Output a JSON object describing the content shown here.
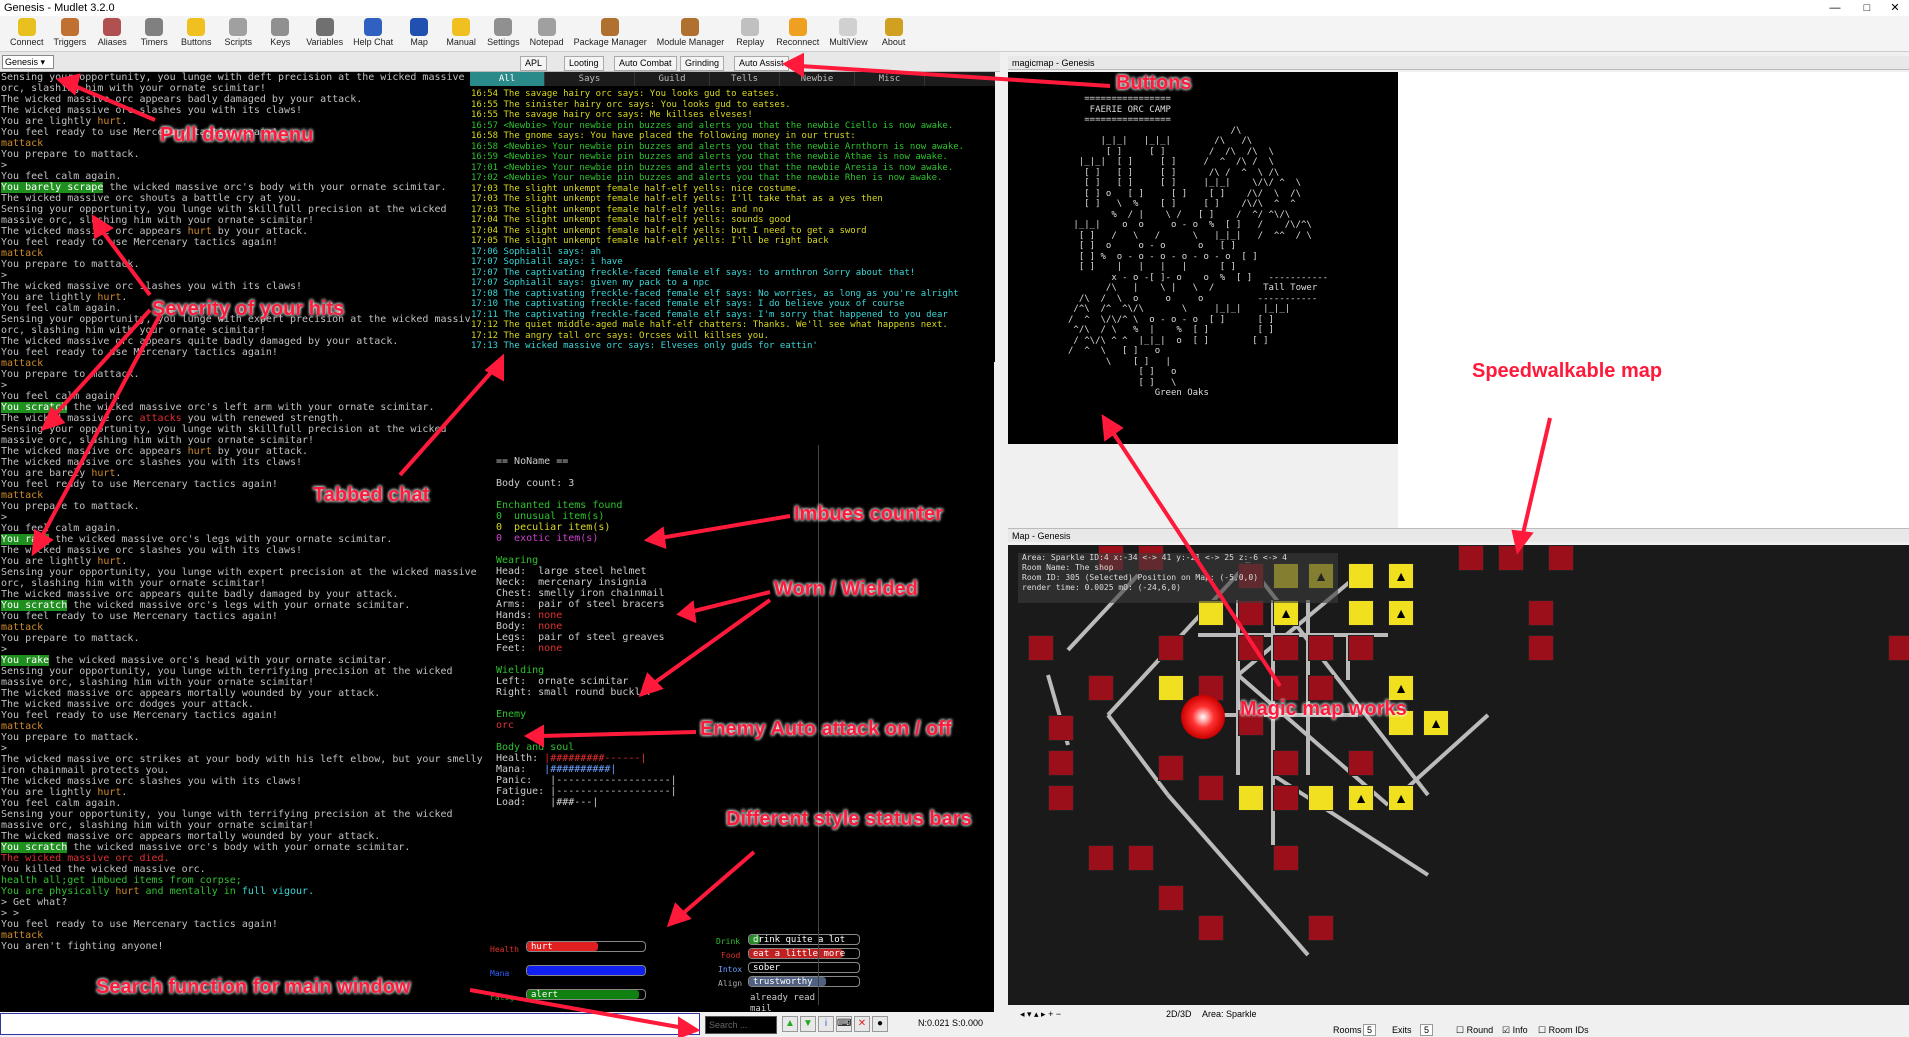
{
  "window": {
    "title": "Genesis - Mudlet 3.2.0",
    "min": "—",
    "max": "□",
    "close": "✕"
  },
  "toolbar": [
    {
      "label": "Connect",
      "icon": "connect-icon",
      "color": "#e8c020"
    },
    {
      "label": "Triggers",
      "icon": "triggers-icon",
      "color": "#c07030"
    },
    {
      "label": "Aliases",
      "icon": "aliases-icon",
      "color": "#b05050"
    },
    {
      "label": "Timers",
      "icon": "timers-icon",
      "color": "#808080"
    },
    {
      "label": "Buttons",
      "icon": "buttons-icon",
      "color": "#f0c020"
    },
    {
      "label": "Scripts",
      "icon": "scripts-icon",
      "color": "#a0a0a0"
    },
    {
      "label": "Keys",
      "icon": "keys-icon",
      "color": "#909090"
    },
    {
      "label": "Variables",
      "icon": "variables-icon",
      "color": "#707070"
    },
    {
      "label": "Help Chat",
      "icon": "chat-icon",
      "color": "#3060c0"
    },
    {
      "label": "Map",
      "icon": "map-icon",
      "color": "#2050b0"
    },
    {
      "label": "Manual",
      "icon": "manual-icon",
      "color": "#f0c020"
    },
    {
      "label": "Settings",
      "icon": "settings-icon",
      "color": "#909090"
    },
    {
      "label": "Notepad",
      "icon": "notepad-icon",
      "color": "#a0a0a0"
    },
    {
      "label": "Package Manager",
      "icon": "package-icon",
      "color": "#b07030"
    },
    {
      "label": "Module Manager",
      "icon": "module-icon",
      "color": "#b07030"
    },
    {
      "label": "Replay",
      "icon": "replay-icon",
      "color": "#c0c0c0"
    },
    {
      "label": "Reconnect",
      "icon": "reconnect-icon",
      "color": "#f0a020"
    },
    {
      "label": "MultiView",
      "icon": "multiview-icon",
      "color": "#d0d0d0"
    },
    {
      "label": "About",
      "icon": "about-icon",
      "color": "#d0a020"
    }
  ],
  "profile": "Genesis ▾",
  "top_tabs": [
    "APL",
    "Looting",
    "Auto Combat",
    "Grinding",
    "Auto Assist"
  ],
  "main_lines": [
    [
      [
        "Sensing your opportunity, you lunge with deft precision at the wicked massive",
        ""
      ]
    ],
    [
      [
        "orc, slashing him with your ornate scimitar!",
        ""
      ]
    ],
    [
      [
        "The wicked massive orc appears badly damaged by your attack.",
        ""
      ]
    ],
    [
      [
        "The wicked massive orc slashes you with its claws!",
        ""
      ]
    ],
    [
      [
        "You are lightly ",
        ""
      ],
      [
        "hurt",
        "or"
      ],
      [
        ".",
        ""
      ]
    ],
    [
      [
        "You feel ready to use Mercenary tactics again!",
        ""
      ]
    ],
    [
      [
        "mattack",
        "or"
      ]
    ],
    [
      [
        "You prepare to mattack.",
        ""
      ]
    ],
    [
      [
        ">",
        ""
      ]
    ],
    [
      [
        "You feel calm again.",
        ""
      ]
    ],
    [
      [
        "You barely scrape",
        "hl"
      ],
      [
        " the wicked massive orc's body with your ornate scimitar.",
        ""
      ]
    ],
    [
      [
        "The wicked massive orc shouts a battle cry at you.",
        ""
      ]
    ],
    [
      [
        "Sensing your opportunity, you lunge with skillfull precision at the wicked",
        ""
      ]
    ],
    [
      [
        "massive orc, slashing him with your ornate scimitar!",
        ""
      ]
    ],
    [
      [
        "The wicked massive orc appears ",
        ""
      ],
      [
        "hurt",
        "or"
      ],
      [
        " by your attack.",
        ""
      ]
    ],
    [
      [
        "You feel ready to use Mercenary tactics again!",
        ""
      ]
    ],
    [
      [
        "mattack",
        "or"
      ]
    ],
    [
      [
        "You prepare to mattack.",
        ""
      ]
    ],
    [
      [
        ">",
        ""
      ]
    ],
    [
      [
        "The wicked massive orc slashes you with its claws!",
        ""
      ]
    ],
    [
      [
        "You are lightly ",
        ""
      ],
      [
        "hurt",
        "or"
      ],
      [
        ".",
        ""
      ]
    ],
    [
      [
        "You feel calm again.",
        ""
      ]
    ],
    [
      [
        "Sensing your opportunity, you lunge with expert precision at the wicked massive",
        ""
      ]
    ],
    [
      [
        "orc, slashing him with your ornate scimitar!",
        ""
      ]
    ],
    [
      [
        "The wicked massive orc appears quite badly damaged by your attack.",
        ""
      ]
    ],
    [
      [
        "You feel ready to use Mercenary tactics again!",
        ""
      ]
    ],
    [
      [
        "mattack",
        "or"
      ]
    ],
    [
      [
        "You prepare to mattack.",
        ""
      ]
    ],
    [
      [
        ">",
        ""
      ]
    ],
    [
      [
        "You feel calm again.",
        ""
      ]
    ],
    [
      [
        "You scratch",
        "hl"
      ],
      [
        " the wicked massive orc's left arm with your ornate scimitar.",
        ""
      ]
    ],
    [
      [
        "The wicked massive orc ",
        ""
      ],
      [
        "attacks",
        "rd"
      ],
      [
        " you with renewed strength.",
        ""
      ]
    ],
    [
      [
        "Sensing your opportunity, you lunge with skillfull precision at the wicked",
        ""
      ]
    ],
    [
      [
        "massive orc, slashing him with your ornate scimitar!",
        ""
      ]
    ],
    [
      [
        "The wicked massive orc appears ",
        ""
      ],
      [
        "hurt",
        "or"
      ],
      [
        " by your attack.",
        ""
      ]
    ],
    [
      [
        "The wicked massive orc slashes you with its claws!",
        ""
      ]
    ],
    [
      [
        "You are barely ",
        ""
      ],
      [
        "hurt",
        "or"
      ],
      [
        ".",
        ""
      ]
    ],
    [
      [
        "You feel ready to use Mercenary tactics again!",
        ""
      ]
    ],
    [
      [
        "mattack",
        "or"
      ]
    ],
    [
      [
        "You prepare to mattack.",
        ""
      ]
    ],
    [
      [
        ">",
        ""
      ]
    ],
    [
      [
        "You feel calm again.",
        ""
      ]
    ],
    [
      [
        "You rake",
        "hl"
      ],
      [
        " the wicked massive orc's legs with your ornate scimitar.",
        ""
      ]
    ],
    [
      [
        "The wicked massive orc slashes you with its claws!",
        ""
      ]
    ],
    [
      [
        "You are lightly ",
        ""
      ],
      [
        "hurt",
        "or"
      ],
      [
        ".",
        ""
      ]
    ],
    [
      [
        "Sensing your opportunity, you lunge with expert precision at the wicked massive",
        ""
      ]
    ],
    [
      [
        "orc, slashing him with your ornate scimitar!",
        ""
      ]
    ],
    [
      [
        "The wicked massive orc appears quite badly damaged by your attack.",
        ""
      ]
    ],
    [
      [
        "You scratch",
        "hl"
      ],
      [
        " the wicked massive orc's legs with your ornate scimitar.",
        ""
      ]
    ],
    [
      [
        "You feel ready to use Mercenary tactics again!",
        ""
      ]
    ],
    [
      [
        "mattack",
        "or"
      ]
    ],
    [
      [
        "You prepare to mattack.",
        ""
      ]
    ],
    [
      [
        ">",
        ""
      ]
    ],
    [
      [
        "You rake",
        "hl"
      ],
      [
        " the wicked massive orc's head with your ornate scimitar.",
        ""
      ]
    ],
    [
      [
        "Sensing your opportunity, you lunge with terrifying precision at the wicked",
        ""
      ]
    ],
    [
      [
        "massive orc, slashing him with your ornate scimitar!",
        ""
      ]
    ],
    [
      [
        "The wicked massive orc appears mortally wounded by your attack.",
        ""
      ]
    ],
    [
      [
        "The wicked massive orc dodges your attack.",
        ""
      ]
    ],
    [
      [
        "You feel ready to use Mercenary tactics again!",
        ""
      ]
    ],
    [
      [
        "mattack",
        "or"
      ]
    ],
    [
      [
        "You prepare to mattack.",
        ""
      ]
    ],
    [
      [
        ">",
        ""
      ]
    ],
    [
      [
        "The wicked massive orc strikes at your body with his left elbow, but your smelly",
        ""
      ]
    ],
    [
      [
        "iron chainmail protects you.",
        ""
      ]
    ],
    [
      [
        "The wicked massive orc slashes you with its claws!",
        ""
      ]
    ],
    [
      [
        "You are lightly ",
        ""
      ],
      [
        "hurt",
        "or"
      ],
      [
        ".",
        ""
      ]
    ],
    [
      [
        "You feel calm again.",
        ""
      ]
    ],
    [
      [
        "Sensing your opportunity, you lunge with terrifying precision at the wicked",
        ""
      ]
    ],
    [
      [
        "massive orc, slashing him with your ornate scimitar!",
        ""
      ]
    ],
    [
      [
        "The wicked massive orc appears mortally wounded by your attack.",
        ""
      ]
    ],
    [
      [
        "You scratch",
        "hl"
      ],
      [
        " the wicked massive orc's body with your ornate scimitar.",
        ""
      ]
    ],
    [
      [
        "The wicked massive orc died.",
        "rd"
      ]
    ],
    [
      [
        "You killed the wicked massive orc.",
        ""
      ]
    ],
    [
      [
        "health all;get imbued items from corpse;",
        "gr"
      ]
    ],
    [
      [
        "You are physically ",
        "gr"
      ],
      [
        "hurt",
        "or"
      ],
      [
        " and mentally in ",
        "gr"
      ],
      [
        "full vigour.",
        "cy"
      ]
    ],
    [
      [
        "> Get what?",
        ""
      ]
    ],
    [
      [
        "> >",
        ""
      ]
    ],
    [
      [
        "You feel ready to use Mercenary tactics again!",
        ""
      ]
    ],
    [
      [
        "mattack",
        "or"
      ]
    ],
    [
      [
        "You aren't fighting anyone!",
        ""
      ]
    ]
  ],
  "chat_tabs": [
    "All",
    "Says",
    "Guild",
    "Tells",
    "Newbie",
    "Misc"
  ],
  "chat_lines": [
    [
      "16:54 The savage hairy orc says: You looks gud to eatses.",
      "yl"
    ],
    [
      "16:55 The sinister hairy orc says: You looks gud to eatses.",
      "yl"
    ],
    [
      "16:55 The savage hairy orc says: Me killses elveses!",
      "yl"
    ],
    [
      "16:57 <Newbie> Your newbie pin buzzes and alerts you that the newbie Ciello is now awake.",
      "gr"
    ],
    [
      "16:58 The gnome says: You have placed the following money in our trust:",
      "yl"
    ],
    [
      "16:58 <Newbie> Your newbie pin buzzes and alerts you that the newbie Arnthorn is now awake.",
      "gr"
    ],
    [
      "16:59 <Newbie> Your newbie pin buzzes and alerts you that the newbie Athae is now awake.",
      "gr"
    ],
    [
      "17:01 <Newbie> Your newbie pin buzzes and alerts you that the newbie Aresia is now awake.",
      "gr"
    ],
    [
      "17:02 <Newbie> Your newbie pin buzzes and alerts you that the newbie Rhen is now awake.",
      "gr"
    ],
    [
      "17:03 The slight unkempt female half-elf yells: nice costume.",
      "yl"
    ],
    [
      "17:03 The slight unkempt female half-elf yells: I'll take that as a yes then",
      "yl"
    ],
    [
      "17:03 The slight unkempt female half-elf yells: and no",
      "yl"
    ],
    [
      "17:04 The slight unkempt female half-elf yells: sounds good",
      "yl"
    ],
    [
      "17:04 The slight unkempt female half-elf yells: but I need to get a sword",
      "yl"
    ],
    [
      "17:05 The slight unkempt female half-elf yells: I'll be right back",
      "yl"
    ],
    [
      "17:06 Sophialil says: ah",
      "cy"
    ],
    [
      "17:07 Sophialil says: i have",
      "cy"
    ],
    [
      "17:07 The captivating freckle-faced female elf says: to arnthron Sorry about that!",
      "cy"
    ],
    [
      "17:07 Sophialil says: given my pack to a npc",
      "cy"
    ],
    [
      "17:08 The captivating freckle-faced female elf says: No worries, as long as you're alright",
      "cy"
    ],
    [
      "17:10 The captivating freckle-faced female elf says: I do believe youx of course",
      "cy"
    ],
    [
      "17:11 The captivating freckle-faced female elf says: I'm sorry that happened to you dear",
      "cy"
    ],
    [
      "17:12 The quiet middle-aged male half-elf chatters: Thanks. We'll see what happens next.",
      "yl"
    ],
    [
      "17:12 The angry tall orc says: Orcses will killses you.",
      "yl"
    ],
    [
      "17:13 The wicked massive orc says: Elveses only guds for eattin'",
      "cy"
    ]
  ],
  "side": {
    "title": "== NoName ==",
    "body_count": "Body count: 3",
    "enchanted_title": "Enchanted items found",
    "unusual": "0  unusual item(s)",
    "peculiar": "0  peculiar item(s)",
    "exotic": "0  exotic item(s)",
    "wearing_title": "Wearing",
    "head": "Head:  large steel helmet",
    "neck": "Neck:  mercenary insignia",
    "chest": "Chest: smelly iron chainmail",
    "arms": "Arms:  pair of steel bracers",
    "hands_k": "Hands: ",
    "hands_v": "none",
    "body_k": "Body:  ",
    "body_v": "none",
    "legs": "Legs:  pair of steel greaves",
    "feet_k": "Feet:  ",
    "feet_v": "none",
    "wield_title": "Wielding",
    "left": "Left:  ornate scimitar",
    "right": "Right: small round buckler",
    "enemy_title": "Enemy",
    "enemy": "orc",
    "bs_title": "Body and soul",
    "health_k": "Health: ",
    "health_v": "|#########------|",
    "mana_k": "Mana:   ",
    "mana_v": "|##########|",
    "panic": "Panic:   |-------------------|",
    "fatigue": "Fatigue: |-------------------|",
    "load": "Load:    |###---|"
  },
  "bars": {
    "health_lbl": "Health",
    "health_txt": "hurt",
    "health_pct": 60,
    "mana_lbl": "Mana",
    "mana_txt": "",
    "mana_pct": 100,
    "fatig_lbl": "Fatig",
    "fatig_txt": "alert",
    "fatig_pct": 95,
    "drink_lbl": "Drink",
    "drink_txt": "drink quite a lot more",
    "drink_pct": 10,
    "food_lbl": "Food",
    "food_txt": "eat a little more",
    "food_pct": 85,
    "intox_lbl": "Intox",
    "intox_txt": "sober",
    "intox_pct": 0,
    "align_lbl": "Align",
    "align_txt": "trustworthy",
    "align_pct": 70,
    "read_mail": "already read mail"
  },
  "cmd": {
    "search_placeholder": "Search ...",
    "status": "N:0.021 S:0.000"
  },
  "magic": {
    "header": "magicmap - Genesis",
    "art": "   ================\n    FAERIE ORC CAMP\n   ================\n                              /\\\n      |_|_|   |_|_|        /\\   /\\\n       [ ]     [ ]        /  /\\  /\\  \\\n  |_|_|  [ ]     [ ]     /  ^  /\\ /  \\\n   [ ]   [ ]     [ ]      /\\ /  ^  \\ /\\\n   [ ]   [ ]     [ ]     |_|_|    \\/\\/ ^  \\\n   [ ] o   [ ]     [ ]    [ ]    /\\/  \\  /\\\n   [ ]   \\  %    [ ]     [ ]    /\\/\\  ^  ^\n        %  / |    \\ /   [ ]    /  ^/ ^\\/\\\n |_|_|    o  o     o - o  %  [ ]   /    /\\/^\\\n  [ ]   /   \\   /      \\   |_|_|   /  ^^  / \\\n  [ ]  o     o - o      o   [ ]\n  [ ] %  o - o - o - o - o - o  [ ]\n  [ ]    |   |   |   |      [ ]\n        x - o -[ ]- o    o  %  [ ]   -----------\n       /\\   |    \\ |   \\  /         Tall Tower\n  /\\  /  \\  o     o     o          -----------\n /^\\  /^  ^\\/\\       \\     |_|_|    |_|_|\n/  ^  \\/\\/^ \\  o - o - o  [ ]      [ ]\n ^/\\  / \\   %  |    %  [ ]         [ ]\n / ^\\/\\ ^ ^  |_|_|  o  [ ]        [ ]\n/  ^  \\   [ ]   o\n       \\    [ ]   |\n             [ ]   o\n             [ ]   \\\n                Green Oaks"
  },
  "map": {
    "header": "Map - Genesis",
    "info1": "Area: Sparkle ID:4 x:-34 <-> 41 y:-21 <-> 25 z:-6 <-> 4",
    "info2": "Room Name: The shop",
    "info3": "Room ID: 305 (Selected) Position on Map: (-5,0,0)",
    "info4": "render time: 0.0025 mO: (-24,6,0)",
    "mode": "2D/3D",
    "area": "Area: Sparkle",
    "rooms_lbl": "Rooms",
    "rooms_val": "5",
    "exits_lbl": "Exits",
    "exits_val": "5",
    "round": "Round",
    "info": "Info",
    "roomids": "Room IDs"
  },
  "annotations": [
    "Pull down menu",
    "Severity of your hits",
    "Tabbed chat",
    "Buttons",
    "Imbues counter",
    "Worn / Wielded",
    "Enemy Auto attack on / off",
    "Different style status bars",
    "Search function for main window",
    "Speedwalkable map",
    "Magic map works"
  ]
}
